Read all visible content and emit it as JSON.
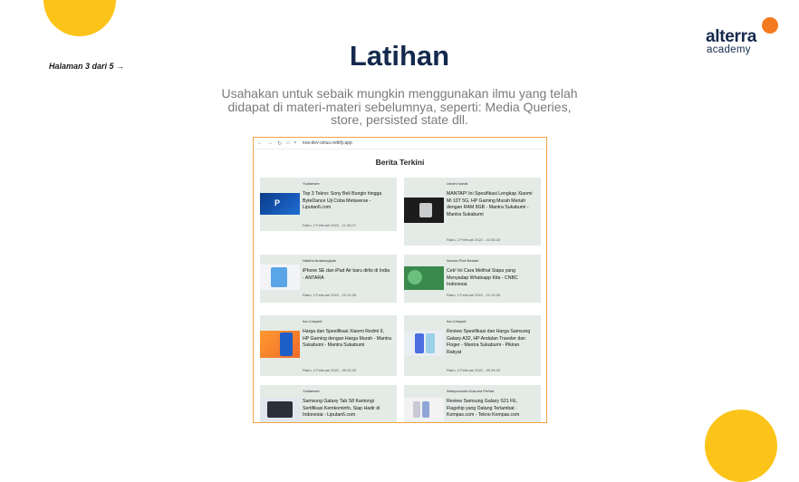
{
  "slide": {
    "page_indicator": "Halaman 3 dari 5 →",
    "title": "Latihan",
    "subtitle": "Usahakan untuk sebaik mungkin menggunakan ilmu yang telah didapat di materi-materi sebelumnya, seperti: Media Queries, store, persisted state dll.",
    "logo_word": "alterra",
    "logo_sub": "academy",
    "colors": {
      "accent_yellow": "#FCC419",
      "accent_orange": "#F47A1F",
      "navy": "#14294d"
    }
  },
  "browser": {
    "url": "nxa-dev-sirius.netlify.app",
    "nav_icons": [
      "back-icon",
      "forward-icon",
      "reload-icon",
      "home-icon",
      "lock-icon"
    ],
    "heading": "Berita Terkini",
    "cards": [
      {
        "author": "Yudiansee",
        "headline": "Top 3 Tekno: Sony Beli Bungin hingga ByteDance Uji Coba Metaverse - Liputan6.com",
        "date": "Rabu, 2 Februari 2022 - 11.30.07",
        "thumb": "playstation"
      },
      {
        "author": "Umam Ismail",
        "headline": "MANTAP! Ini Spesifikasi Lengkap Xiaomi Mi 10T 5G, HP Gaming Murah Meriah dengan RAM 8GB - Mantra Sukabumi - Mantra Sukabumi",
        "date": "Rabu, 2 Februari 2022 - 10.50.03",
        "thumb": "xiaomi"
      },
      {
        "author": "Nabiha Ardaningtyas",
        "headline": "iPhone SE dan iPad Air baru dirlis di India - ANTARA",
        "date": "Rabu, 2 Februari 2022 - 10.10.05",
        "thumb": "ipad"
      },
      {
        "author": "Novina Putri Bestari",
        "headline": "Cek! Ini Cara Melihat Siapa yang Menyadap Whatsapp Kita - CNBC Indonesia",
        "date": "Rabu, 2 Februari 2022 - 10.10.05",
        "thumb": "whatsapp"
      },
      {
        "author": "Ina Cahyadi",
        "headline": "Harga dan Spesifikasi Xiaomi Redmi 9, HP Gaming dengan Harga Murah - Mantra Sukabumi - Mantra Sukabumi",
        "date": "Rabu, 2 Februari 2022 - 09.40.00",
        "thumb": "redmi"
      },
      {
        "author": "Ina Cahyadi",
        "headline": "Review Spesifikasi dan Harga Samsung Galaxy A32, HP Andalan Traveler dan Floger - Mantra Sukabumi - Pikiran Rakyat",
        "date": "Rabu, 2 Februari 2022 - 09.35.03",
        "thumb": "samsung"
      },
      {
        "author": "Yudiansee",
        "headline": "Samsung Galaxy Tab S8 Kantongi Sertifikasi Kemkominfo, Siap Hadir di Indonesia - Liputan6.com",
        "date": "",
        "thumb": "tab"
      },
      {
        "author": "Wahyunanda Kusuma Pertiwi",
        "headline": "Review Samsung Galaxy S21 FE, Flagship yang Datang Terlambat - Kompas.com - Tekno Kompas.com",
        "date": "",
        "thumb": "s21"
      }
    ]
  }
}
